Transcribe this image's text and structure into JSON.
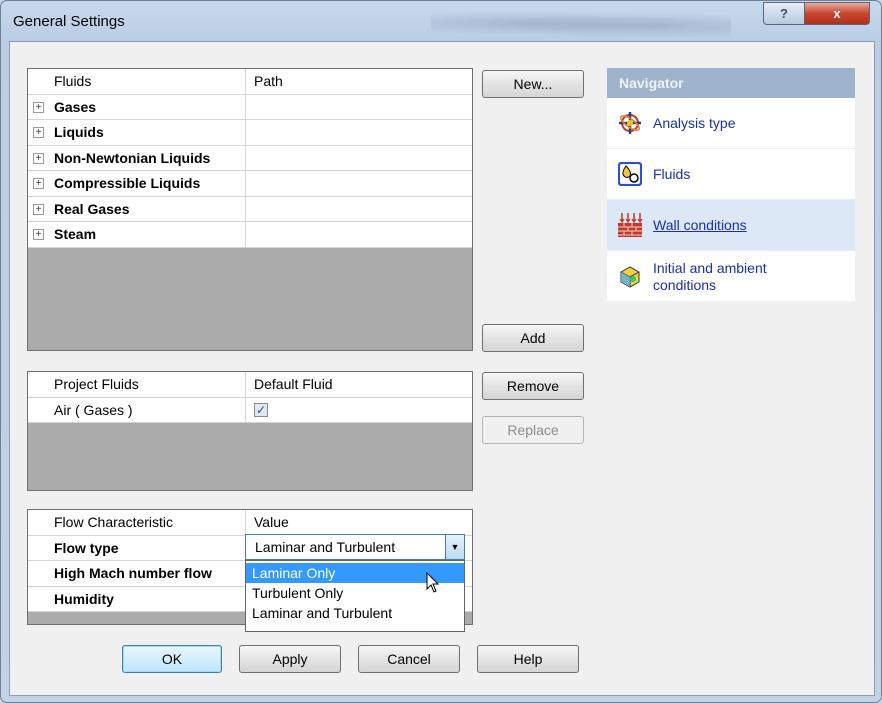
{
  "window": {
    "title": "General Settings",
    "help_btn": "?",
    "close_btn": "x"
  },
  "fluids_grid": {
    "columns": [
      "Fluids",
      "Path"
    ],
    "rows": [
      {
        "name": "Gases",
        "path": ""
      },
      {
        "name": "Liquids",
        "path": ""
      },
      {
        "name": "Non-Newtonian Liquids",
        "path": ""
      },
      {
        "name": "Compressible Liquids",
        "path": ""
      },
      {
        "name": "Real Gases",
        "path": ""
      },
      {
        "name": "Steam",
        "path": ""
      }
    ],
    "expander": "+"
  },
  "project_grid": {
    "columns": [
      "Project Fluids",
      "Default Fluid"
    ],
    "rows": [
      {
        "name": "Air ( Gases )",
        "default": true
      }
    ],
    "check": "✓"
  },
  "flow_grid": {
    "columns": [
      "Flow Characteristic",
      "Value"
    ],
    "rows": [
      {
        "name": "Flow type",
        "value": "Laminar and Turbulent"
      },
      {
        "name": "High Mach number flow",
        "value": ""
      },
      {
        "name": "Humidity",
        "value": ""
      }
    ]
  },
  "flow_type_dropdown": {
    "selected": "Laminar and Turbulent",
    "options": [
      "Laminar Only",
      "Turbulent Only",
      "Laminar and Turbulent"
    ],
    "highlighted": "Laminar Only"
  },
  "buttons": {
    "new": "New...",
    "add": "Add",
    "remove": "Remove",
    "replace": "Replace",
    "ok": "OK",
    "apply": "Apply",
    "cancel": "Cancel",
    "help": "Help"
  },
  "navigator": {
    "title": "Navigator",
    "items": [
      {
        "label": "Analysis type",
        "icon": "analysis-type-icon"
      },
      {
        "label": "Fluids",
        "icon": "fluids-icon"
      },
      {
        "label": "Wall conditions",
        "icon": "wall-conditions-icon"
      },
      {
        "label": "Initial and ambient conditions",
        "icon": "initial-conditions-icon"
      }
    ]
  },
  "colors": {
    "nav_header": "#9fb4cc",
    "nav_link": "#1a2fb5",
    "selection": "#3399ff",
    "grid_empty": "#ababab"
  }
}
